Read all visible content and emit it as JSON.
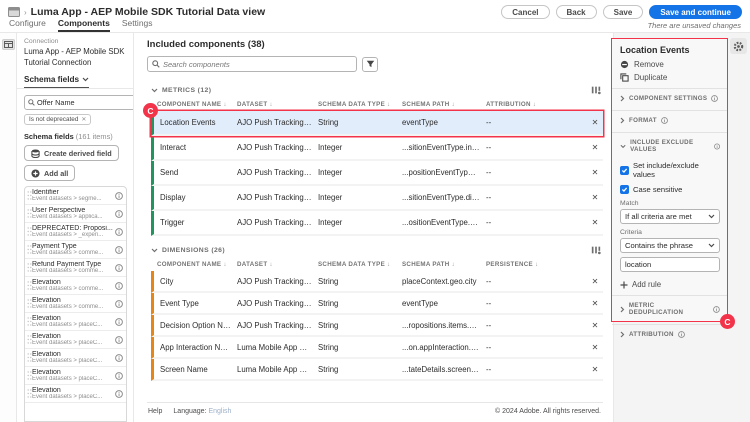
{
  "callouts": {
    "row_label": "C",
    "panel_label": "C"
  },
  "colors": {
    "annotation_red": "#f23349",
    "primary_blue": "#1473e6",
    "metric_green": "#23945f",
    "dimension_orange": "#e68619"
  },
  "header": {
    "title": "Luma App - AEP Mobile SDK Tutorial Data view",
    "buttons": {
      "cancel": "Cancel",
      "back": "Back",
      "save": "Save",
      "save_continue": "Save and continue"
    },
    "unsaved_note": "There are unsaved changes",
    "tabs": {
      "configure": "Configure",
      "components": "Components",
      "settings": "Settings"
    }
  },
  "sidebar": {
    "connection_label": "Connection",
    "connection_name": "Luma App - AEP Mobile SDK Tutorial Connection",
    "fields_tab_label": "Schema fields",
    "search_value": "Offer Name",
    "filter_chip": "Is not deprecated",
    "list_title": "Schema fields",
    "list_count": "(161 items)",
    "create_derived_label": "Create derived field",
    "add_all_label": "Add all",
    "fields": [
      {
        "name": "Identifier",
        "path": "Event datasets > segme..."
      },
      {
        "name": "User Perspective",
        "path": "Event datasets > applica..."
      },
      {
        "name": "DEPRECATED: Proposi...",
        "path": "Event datasets > _experi..."
      },
      {
        "name": "Payment Type",
        "path": "Event datasets > comme..."
      },
      {
        "name": "Refund Payment Type",
        "path": "Event datasets > comme..."
      },
      {
        "name": "Elevation",
        "path": "Event datasets > comme..."
      },
      {
        "name": "Elevation",
        "path": "Event datasets > comme..."
      },
      {
        "name": "Elevation",
        "path": "Event datasets > placeC..."
      },
      {
        "name": "Elevation",
        "path": "Event datasets > placeC..."
      },
      {
        "name": "Elevation",
        "path": "Event datasets > placeC..."
      },
      {
        "name": "Elevation",
        "path": "Event datasets > placeC..."
      },
      {
        "name": "Elevation",
        "path": "Event datasets > placeC..."
      }
    ]
  },
  "main": {
    "title": "Included components (38)",
    "search_placeholder": "Search components",
    "metrics": {
      "section_label": "METRICS (12)",
      "columns": [
        "COMPONENT NAME",
        "DATASET",
        "SCHEMA DATA TYPE",
        "SCHEMA PATH",
        "ATTRIBUTION"
      ],
      "rows": [
        {
          "name": "Location Events",
          "dataset": "AJO Push Tracking Expe...",
          "type": "String",
          "path": "eventType",
          "last": "--",
          "selected": true
        },
        {
          "name": "Interact",
          "dataset": "AJO Push Tracking Expe...",
          "type": "Integer",
          "path": "...sitionEventType.interact",
          "last": "--"
        },
        {
          "name": "Send",
          "dataset": "AJO Push Tracking Expe...",
          "type": "Integer",
          "path": "...positionEventType.send",
          "last": "--"
        },
        {
          "name": "Display",
          "dataset": "AJO Push Tracking Expe...",
          "type": "Integer",
          "path": "...sitionEventType.display",
          "last": "--"
        },
        {
          "name": "Trigger",
          "dataset": "AJO Push Tracking Expe...",
          "type": "Integer",
          "path": "...ositionEventType.trigger",
          "last": "--"
        }
      ]
    },
    "dimensions": {
      "section_label": "DIMENSIONS (26)",
      "columns": [
        "COMPONENT NAME",
        "DATASET",
        "SCHEMA DATA TYPE",
        "SCHEMA PATH",
        "PERSISTENCE"
      ],
      "rows": [
        {
          "name": "City",
          "dataset": "AJO Push Tracking Expe...",
          "type": "String",
          "path": "placeContext.geo.city",
          "last": "--"
        },
        {
          "name": "Event Type",
          "dataset": "AJO Push Tracking Expe...",
          "type": "String",
          "path": "eventType",
          "last": "--"
        },
        {
          "name": "Decision Option Name",
          "dataset": "AJO Push Tracking Expe...",
          "type": "String",
          "path": "...ropositions.items.name",
          "last": "--"
        },
        {
          "name": "App Interaction Name",
          "dataset": "Luma Mobile App Event...",
          "type": "String",
          "path": "...on.appInteraction.name",
          "last": "--"
        },
        {
          "name": "Screen Name",
          "dataset": "Luma Mobile App Event...",
          "type": "String",
          "path": "...tateDetails.screenName",
          "last": "--"
        }
      ]
    },
    "footer": {
      "help": "Help",
      "language_label": "Language:",
      "language_value": "English",
      "copyright": "© 2024 Adobe. All rights reserved."
    }
  },
  "panel": {
    "title": "Location Events",
    "remove_label": "Remove",
    "duplicate_label": "Duplicate",
    "component_settings_label": "COMPONENT SETTINGS",
    "format_label": "FORMAT",
    "include_exclude_label": "INCLUDE EXCLUDE VALUES",
    "set_values_label": "Set include/exclude values",
    "case_sensitive_label": "Case sensitive",
    "match_label": "Match",
    "match_value": "If all criteria are met",
    "criteria_label": "Criteria",
    "criteria_value": "Contains the phrase",
    "criteria_input_value": "location",
    "add_rule_label": "Add rule",
    "metric_dedup_label": "METRIC DEDUPLICATION",
    "attribution_label": "ATTRIBUTION"
  }
}
